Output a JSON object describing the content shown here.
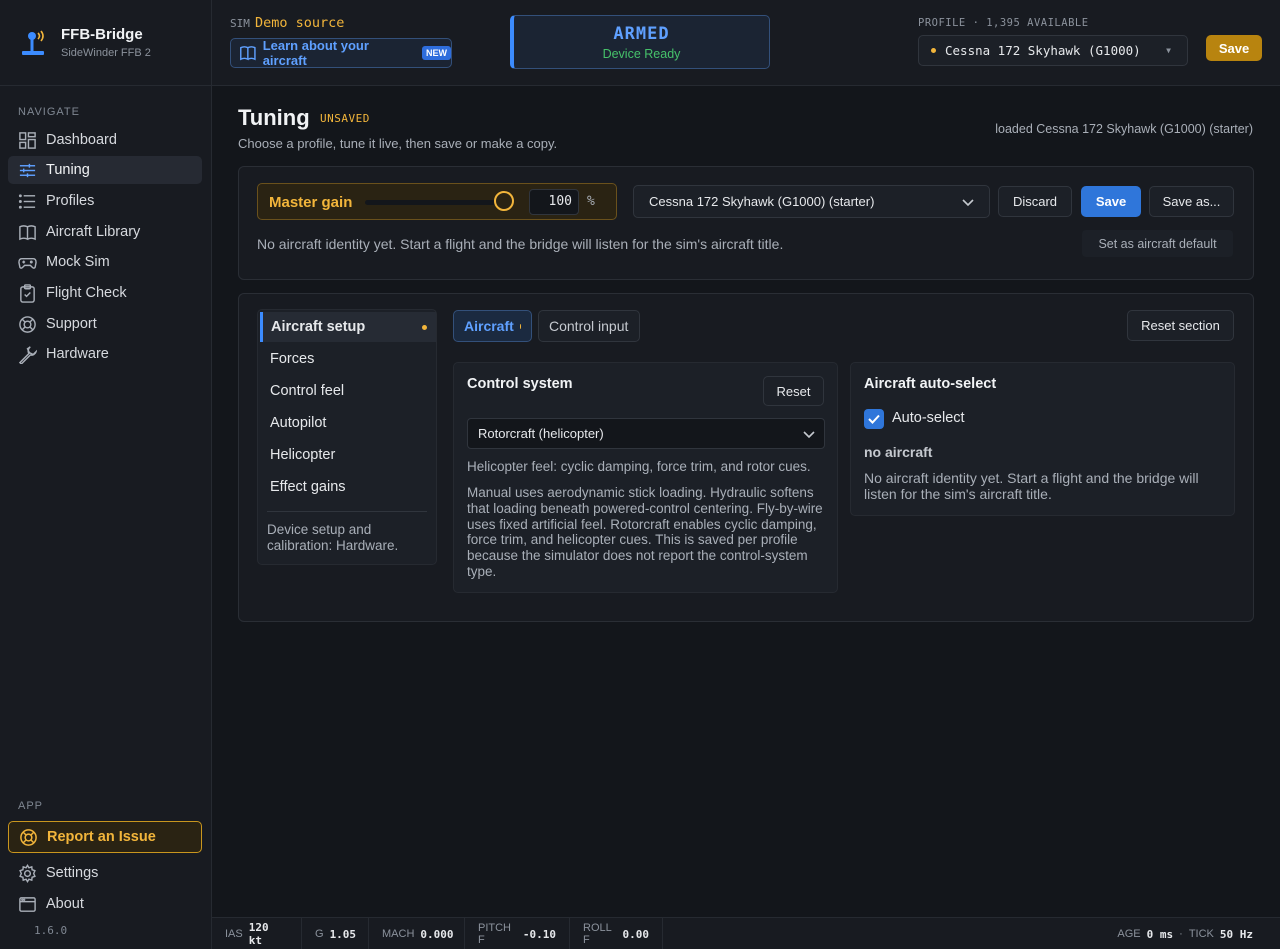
{
  "brand": {
    "title": "FFB-Bridge",
    "subtitle": "SideWinder FFB 2"
  },
  "nav": {
    "heading": "NAVIGATE",
    "items": [
      {
        "label": "Dashboard",
        "icon": "dashboard-icon"
      },
      {
        "label": "Tuning",
        "icon": "sliders-icon",
        "active": true
      },
      {
        "label": "Profiles",
        "icon": "list-icon"
      },
      {
        "label": "Aircraft Library",
        "icon": "book-icon"
      },
      {
        "label": "Mock Sim",
        "icon": "gamepad-icon"
      },
      {
        "label": "Flight Check",
        "icon": "clipboard-icon"
      },
      {
        "label": "Support",
        "icon": "lifebuoy-icon"
      },
      {
        "label": "Hardware",
        "icon": "wrench-icon"
      }
    ],
    "app_heading": "APP",
    "report": "Report an Issue",
    "settings": "Settings",
    "about": "About",
    "version": "1.6.0"
  },
  "topbar": {
    "sim_label": "SIM",
    "sim_source": "Demo source",
    "learn": "Learn about your aircraft",
    "new_badge": "NEW",
    "armed_title": "ARMED",
    "armed_sub": "Device Ready",
    "profile_label": "PROFILE · 1,395 AVAILABLE",
    "profile_value": "Cessna 172 Skyhawk (G1000)",
    "save": "Save"
  },
  "page": {
    "title": "Tuning",
    "unsaved": "UNSAVED",
    "subtitle": "Choose a profile, tune it live, then save or make a copy.",
    "loaded": "loaded Cessna 172 Skyhawk (G1000) (starter)"
  },
  "gain": {
    "label": "Master gain",
    "value": "100",
    "unit": "%",
    "level": 1.0
  },
  "profile_bar": {
    "aircraft": "Cessna 172 Skyhawk (G1000) (starter)",
    "discard": "Discard",
    "save": "Save",
    "save_as": "Save as...",
    "info": "No aircraft identity yet. Start a flight and the bridge will listen for the sim's aircraft title.",
    "set_default": "Set as aircraft default"
  },
  "sections": {
    "items": [
      {
        "label": "Aircraft setup",
        "active": true
      },
      {
        "label": "Forces"
      },
      {
        "label": "Control feel"
      },
      {
        "label": "Autopilot"
      },
      {
        "label": "Helicopter"
      },
      {
        "label": "Effect gains"
      }
    ],
    "note": "Device setup and calibration: Hardware."
  },
  "panel_tabs": {
    "aircraft": "Aircraft",
    "control_input": "Control input",
    "reset_section": "Reset section"
  },
  "control_system": {
    "title": "Control system",
    "reset": "Reset",
    "selected": "Rotorcraft (helicopter)",
    "feel": "Helicopter feel: cyclic damping, force trim, and rotor cues.",
    "description": "Manual uses aerodynamic stick loading. Hydraulic softens that loading beneath powered-control centering. Fly-by-wire uses fixed artificial feel. Rotorcraft enables cyclic damping, force trim, and helicopter cues. This is saved per profile because the simulator does not report the control-system type."
  },
  "auto_select": {
    "title": "Aircraft auto-select",
    "checkbox": "Auto-select",
    "checked": true,
    "status": "no aircraft",
    "description": "No aircraft identity yet. Start a flight and the bridge will listen for the sim's aircraft title."
  },
  "statusbar": {
    "ias_label": "IAS",
    "ias": "120 kt",
    "g_label": "G",
    "g": "1.05",
    "mach_label": "MACH",
    "mach": "0.000",
    "pitch_label": "PITCH F",
    "pitch": "-0.10",
    "roll_label": "ROLL F",
    "roll": "0.00",
    "age_label": "AGE",
    "age": "0 ms",
    "sep": "·",
    "tick_label": "TICK",
    "tick": "50 Hz"
  },
  "colors": {
    "accent": "#2f76da",
    "warning": "#f2b53b",
    "success": "#46c16a",
    "background": "#13161b"
  }
}
